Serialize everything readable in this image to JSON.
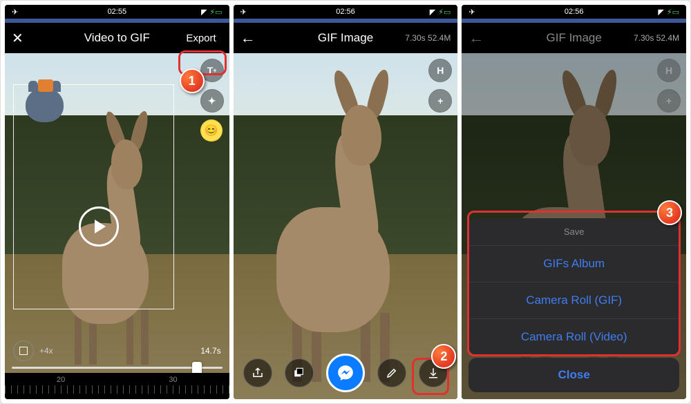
{
  "screen1": {
    "status": {
      "time": "02:55",
      "plane": "✈︎",
      "battery": "⚡︎"
    },
    "nav": {
      "title": "Video to GIF",
      "export": "Export"
    },
    "tools": {
      "text": "T",
      "sticker": "✦",
      "emoji": "😊"
    },
    "bottom": {
      "speed": "+4x",
      "duration": "14.7s"
    },
    "ruler": {
      "a": "20",
      "b": "30"
    }
  },
  "screen2": {
    "status": {
      "time": "02:56"
    },
    "nav": {
      "title": "GIF Image",
      "info": "7.30s 52.4M"
    },
    "tools": {
      "h": "H",
      "plus": "+"
    }
  },
  "screen3": {
    "status": {
      "time": "02:56"
    },
    "nav": {
      "title": "GIF Image",
      "info": "7.30s 52.4M"
    },
    "tools": {
      "h": "H",
      "plus": "+"
    },
    "sheet": {
      "header": "Save",
      "opt1": "GIFs Album",
      "opt2": "Camera Roll (GIF)",
      "opt3": "Camera Roll (Video)",
      "close": "Close"
    }
  },
  "callouts": {
    "c1": "1",
    "c2": "2",
    "c3": "3"
  }
}
